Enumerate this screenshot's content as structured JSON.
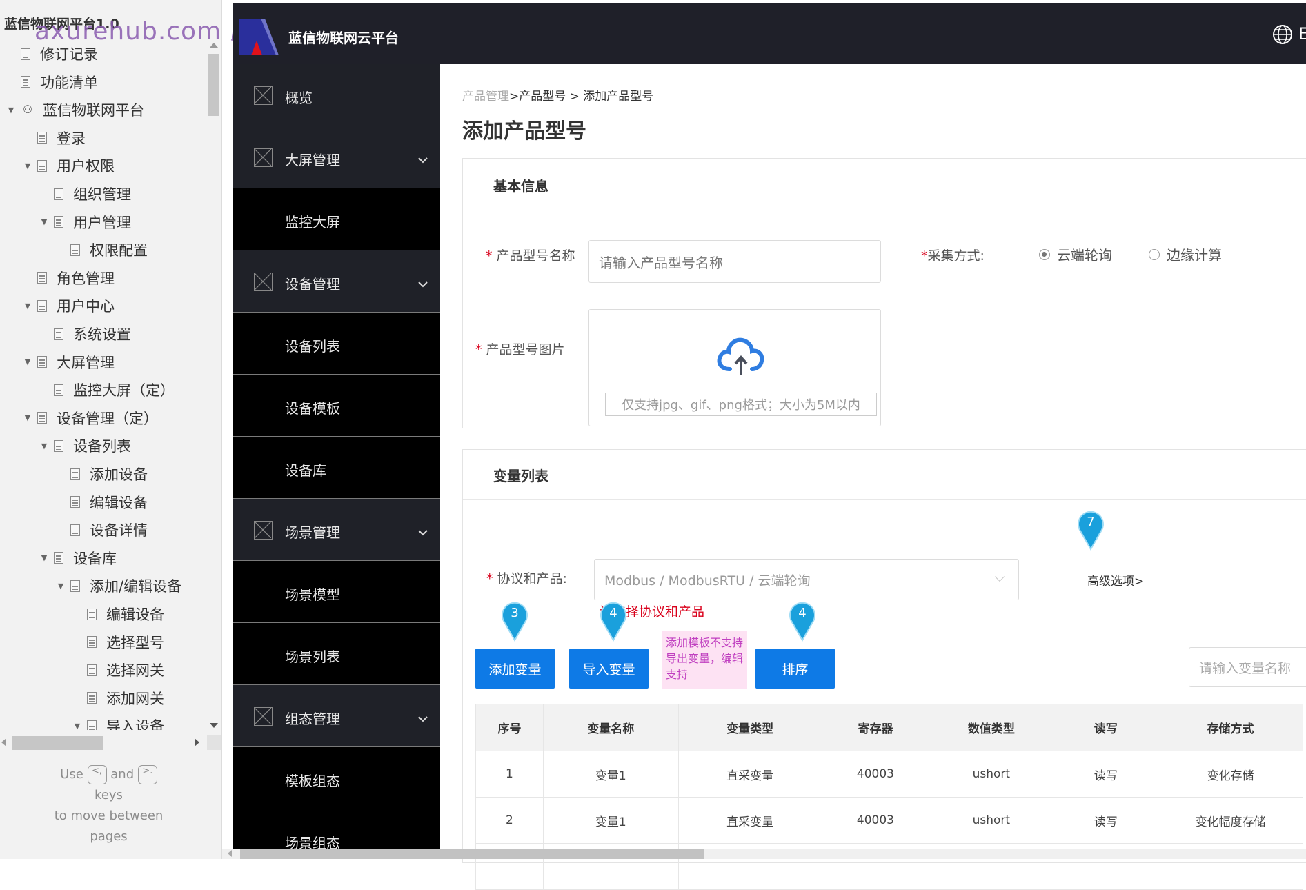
{
  "tree": {
    "project_title": "蓝信物联网平台1.0",
    "watermark": "axurehub.com 原型资源站",
    "items": [
      {
        "label": "修订记录",
        "level": 0,
        "arrow": false,
        "icon": "page-icon"
      },
      {
        "label": "功能清单",
        "level": 0,
        "arrow": false,
        "icon": "page-icon"
      },
      {
        "label": "蓝信物联网平台",
        "level": 0,
        "arrow": true,
        "icon": "folder-icon"
      },
      {
        "label": "登录",
        "level": 1,
        "arrow": false,
        "icon": "page-icon"
      },
      {
        "label": "用户权限",
        "level": 1,
        "arrow": true,
        "icon": "page-icon"
      },
      {
        "label": "组织管理",
        "level": 2,
        "arrow": false,
        "icon": "page-icon"
      },
      {
        "label": "用户管理",
        "level": 2,
        "arrow": true,
        "icon": "page-icon"
      },
      {
        "label": "权限配置",
        "level": 3,
        "arrow": false,
        "icon": "page-icon"
      },
      {
        "label": "角色管理",
        "level": 1,
        "arrow": false,
        "icon": "page-icon"
      },
      {
        "label": "用户中心",
        "level": 1,
        "arrow": true,
        "icon": "page-icon"
      },
      {
        "label": "系统设置",
        "level": 2,
        "arrow": false,
        "icon": "page-icon"
      },
      {
        "label": "大屏管理",
        "level": 1,
        "arrow": true,
        "icon": "page-icon"
      },
      {
        "label": "监控大屏（定）",
        "level": 2,
        "arrow": false,
        "icon": "page-icon"
      },
      {
        "label": "设备管理（定）",
        "level": 1,
        "arrow": true,
        "icon": "page-icon"
      },
      {
        "label": "设备列表",
        "level": 2,
        "arrow": true,
        "icon": "page-icon"
      },
      {
        "label": "添加设备",
        "level": 3,
        "arrow": false,
        "icon": "page-icon"
      },
      {
        "label": "编辑设备",
        "level": 3,
        "arrow": false,
        "icon": "page-icon"
      },
      {
        "label": "设备详情",
        "level": 3,
        "arrow": false,
        "icon": "page-icon"
      },
      {
        "label": "设备库",
        "level": 2,
        "arrow": true,
        "icon": "page-icon"
      },
      {
        "label": "添加/编辑设备",
        "level": 3,
        "arrow": true,
        "icon": "page-icon"
      },
      {
        "label": "编辑设备",
        "level": 4,
        "arrow": false,
        "icon": "page-icon"
      },
      {
        "label": "选择型号",
        "level": 4,
        "arrow": false,
        "icon": "page-icon"
      },
      {
        "label": "选择网关",
        "level": 4,
        "arrow": false,
        "icon": "page-icon"
      },
      {
        "label": "添加网关",
        "level": 4,
        "arrow": false,
        "icon": "page-icon"
      },
      {
        "label": "导入设备",
        "level": 4,
        "arrow": true,
        "icon": "page-icon"
      }
    ],
    "hint": {
      "use": "Use",
      "prev_key": "<,",
      "and": "and",
      "next_key": ">.",
      "keys": "keys",
      "line3": "to move between",
      "line4": "pages"
    }
  },
  "header": {
    "app_title": "蓝信物联网云平台",
    "lang_icon": "globe-icon",
    "lang_text": "E"
  },
  "nav": {
    "items": [
      {
        "label": "概览",
        "type": "parent",
        "expandable": false
      },
      {
        "label": "大屏管理",
        "type": "parent",
        "expandable": true
      },
      {
        "label": "监控大屏",
        "type": "child"
      },
      {
        "label": "设备管理",
        "type": "parent",
        "expandable": true
      },
      {
        "label": "设备列表",
        "type": "child"
      },
      {
        "label": "设备模板",
        "type": "child"
      },
      {
        "label": "设备库",
        "type": "child"
      },
      {
        "label": "场景管理",
        "type": "parent",
        "expandable": true
      },
      {
        "label": "场景模型",
        "type": "child"
      },
      {
        "label": "场景列表",
        "type": "child"
      },
      {
        "label": "组态管理",
        "type": "parent",
        "expandable": true
      },
      {
        "label": "模板组态",
        "type": "child"
      },
      {
        "label": "场景组态",
        "type": "child"
      }
    ]
  },
  "main": {
    "breadcrumb": {
      "first": "产品管理",
      "rest": ">产品型号 > 添加产品型号"
    },
    "page_title": "添加产品型号",
    "basic_info": {
      "title": "基本信息",
      "name_label": "产品型号名称",
      "name_placeholder": "请输入产品型号名称",
      "collect_label": "采集方式:",
      "collect_options": [
        {
          "label": "云端轮询",
          "selected": true
        },
        {
          "label": "边缘计算",
          "selected": false
        }
      ],
      "image_label": "产品型号图片",
      "upload_hint": "仅支持jpg、gif、png格式；大小为5M以内",
      "required_mark": "*"
    },
    "variables": {
      "title": "变量列表",
      "protocol_label": "协议和产品:",
      "protocol_value": "Modbus / ModbusRTU / 云端轮询",
      "protocol_error": "请选择协议和产品",
      "advanced_link": "高级选项>",
      "buttons": {
        "add": "添加变量",
        "import": "导入变量",
        "sort": "排序"
      },
      "note": "添加模板不支持导出变量，编辑支持",
      "search_placeholder": "请输入变量名称",
      "markers": {
        "add": "3",
        "import": "4",
        "sort": "4",
        "advanced": "7"
      },
      "table": {
        "columns": [
          "序号",
          "变量名称",
          "变量类型",
          "寄存器",
          "数值类型",
          "读写",
          "存储方式"
        ],
        "rows": [
          [
            "1",
            "变量1",
            "直采变量",
            "40003",
            "ushort",
            "读写",
            "变化存储"
          ],
          [
            "2",
            "变量1",
            "直采变量",
            "40003",
            "ushort",
            "读写",
            "变化幅度存储"
          ]
        ]
      }
    }
  },
  "colors": {
    "header_bg": "#1f2029",
    "nav_parent_bg": "#1f2128",
    "nav_child_bg": "#000000",
    "primary_button": "#0e7ae6",
    "marker": "#1aa0dc",
    "error": "#d9001b",
    "note_bg": "#fde2f3",
    "note_text": "#c03fc0"
  }
}
